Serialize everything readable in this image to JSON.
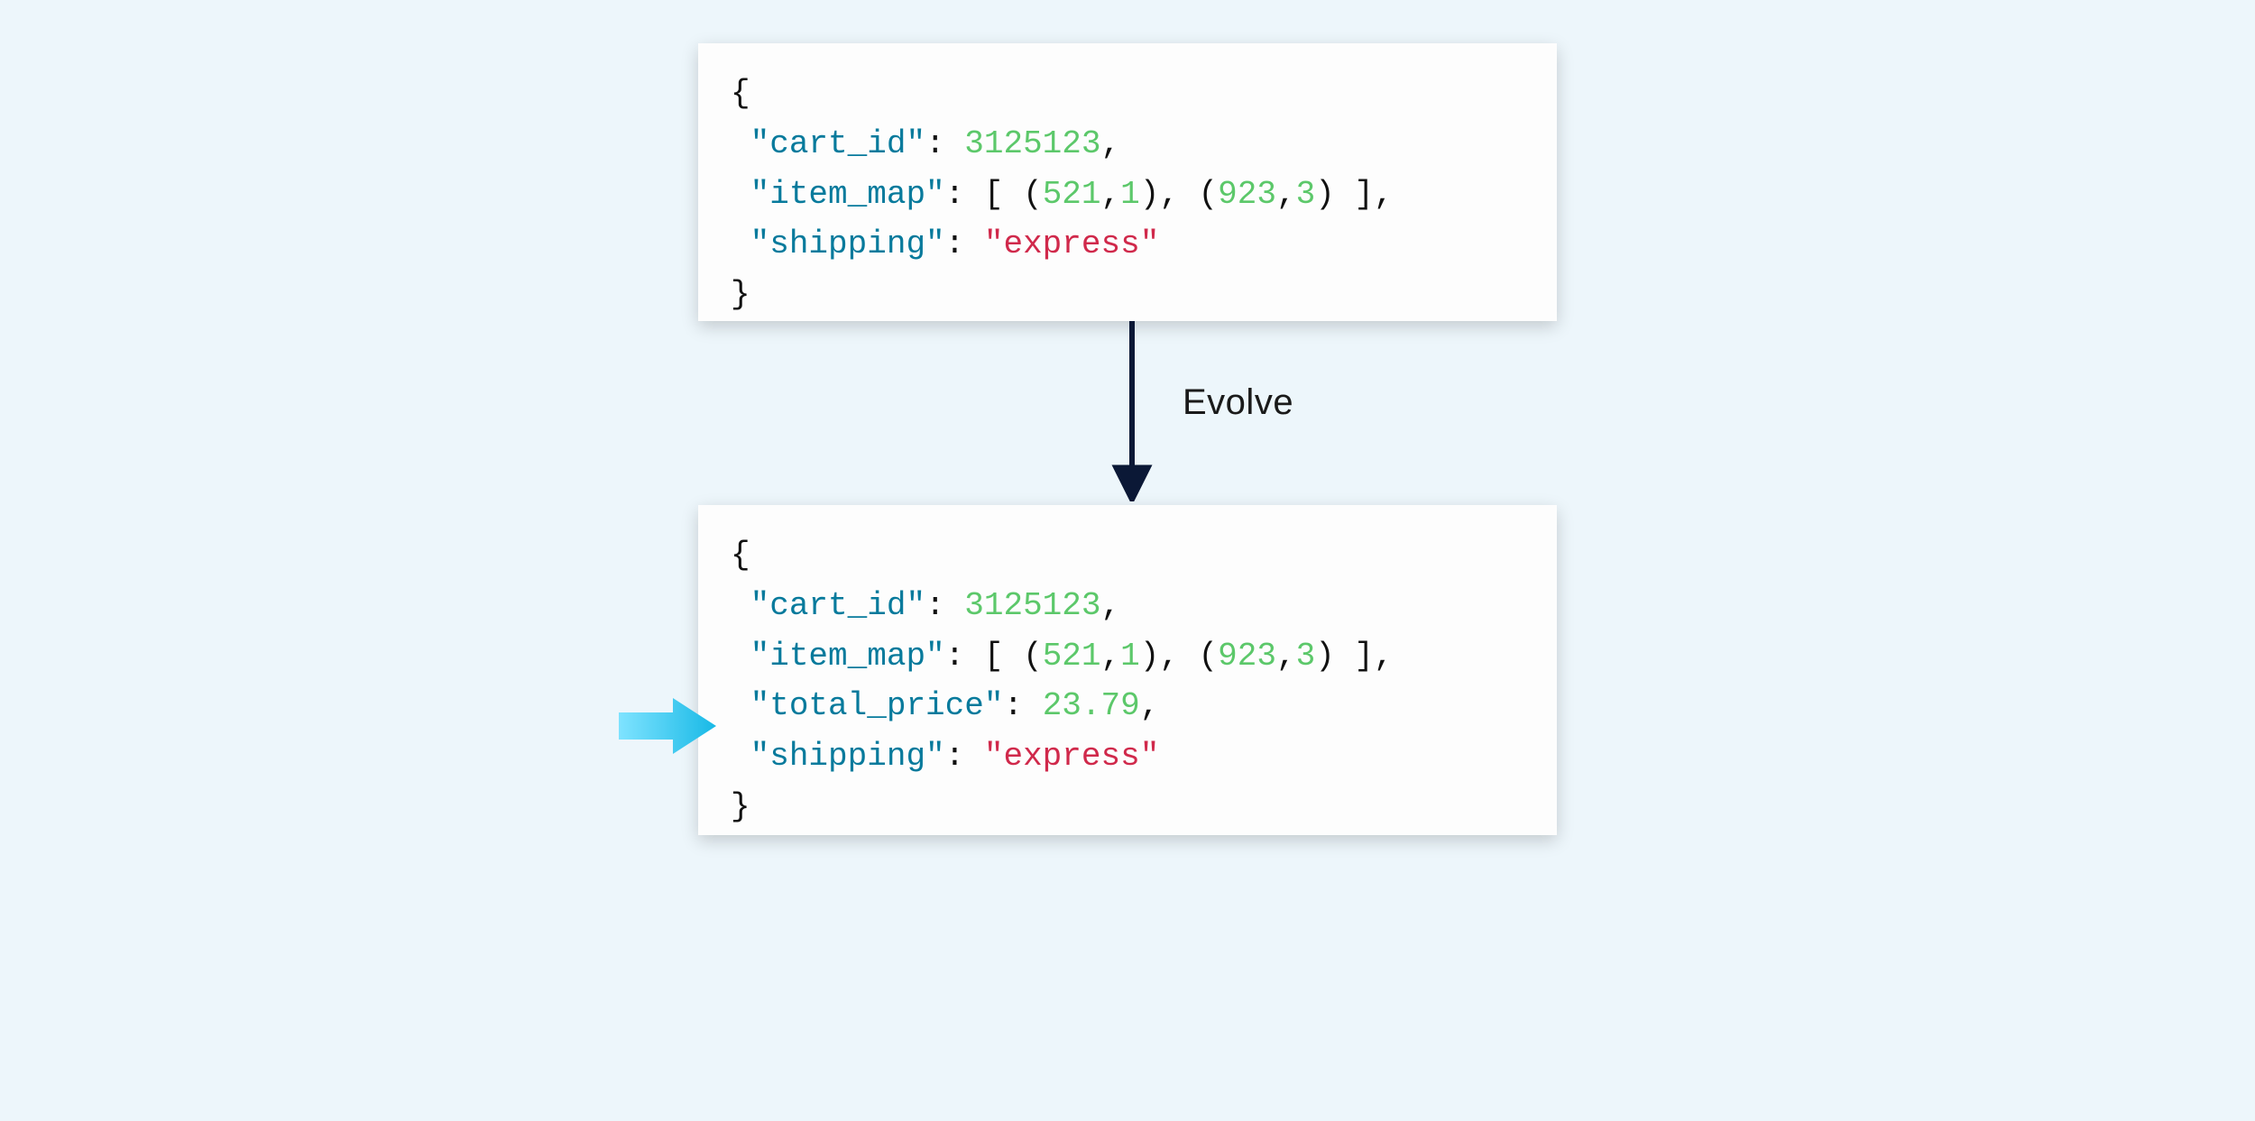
{
  "arrow_label": "Evolve",
  "box1": {
    "brace_open": "{",
    "brace_close": "}",
    "line1": {
      "key": "\"cart_id\"",
      "colon": ": ",
      "val": "3125123",
      "tail": ","
    },
    "line2": {
      "key": "\"item_map\"",
      "colon": ": ",
      "lb": "[ (",
      "a1": "521",
      "c1": ",",
      "a2": "1",
      "mid": "), (",
      "b1": "923",
      "c2": ",",
      "b2": "3",
      "rb": ") ]",
      "tail": ","
    },
    "line3": {
      "key": "\"shipping\"",
      "colon": ": ",
      "val": "\"express\""
    }
  },
  "box2": {
    "brace_open": "{",
    "brace_close": "}",
    "line1": {
      "key": "\"cart_id\"",
      "colon": ": ",
      "val": "3125123",
      "tail": ","
    },
    "line2": {
      "key": "\"item_map\"",
      "colon": ": ",
      "lb": "[ (",
      "a1": "521",
      "c1": ",",
      "a2": "1",
      "mid": "), (",
      "b1": "923",
      "c2": ",",
      "b2": "3",
      "rb": ") ]",
      "tail": ","
    },
    "line3": {
      "key": "\"total_price\"",
      "colon": ": ",
      "val": "23.79",
      "tail": ","
    },
    "line4": {
      "key": "\"shipping\"",
      "colon": ": ",
      "val": "\"express\""
    }
  }
}
